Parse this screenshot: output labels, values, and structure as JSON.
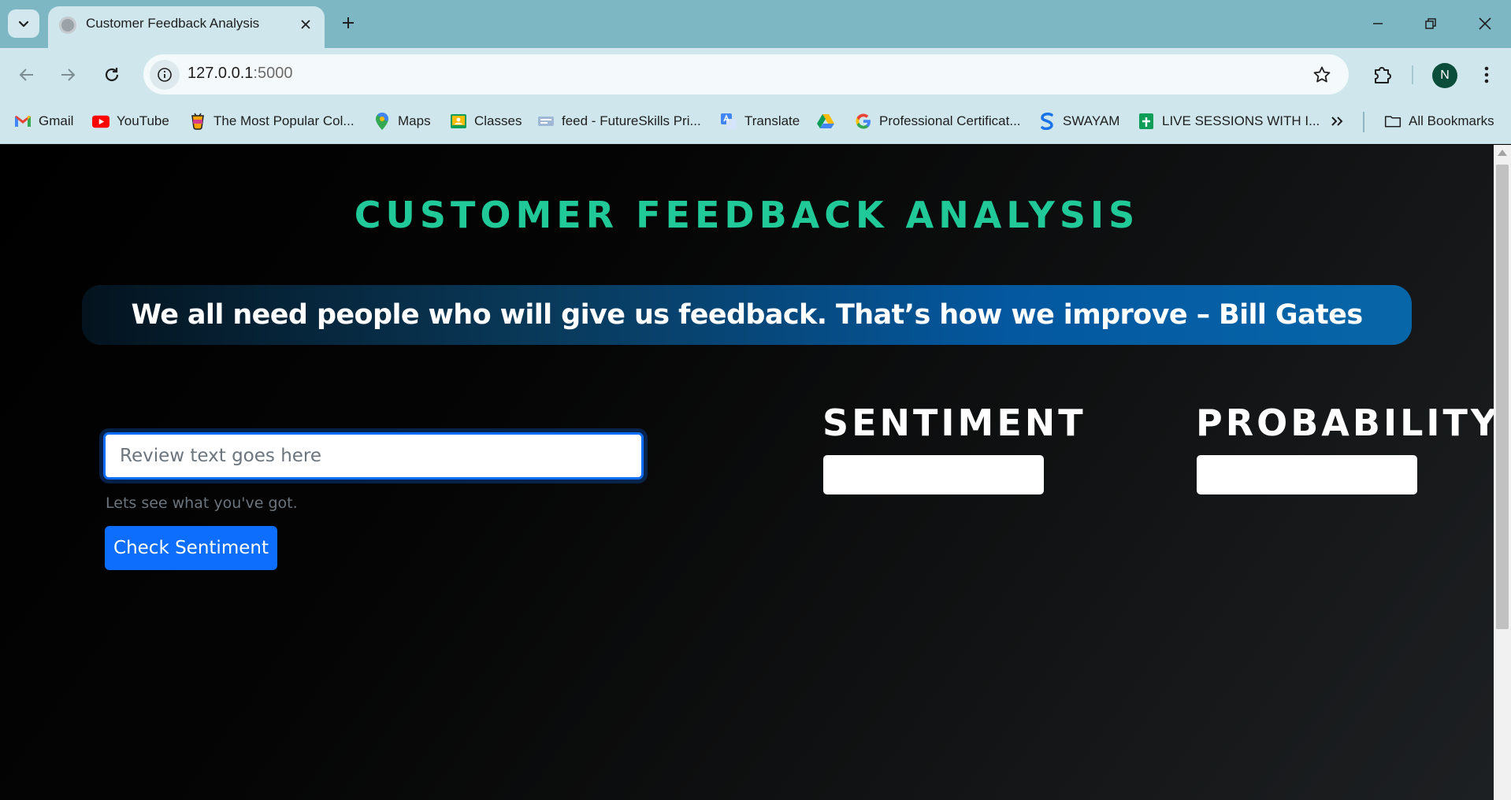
{
  "browser": {
    "tab": {
      "title": "Customer Feedback Analysis"
    },
    "address": {
      "host": "127.0.0.1",
      "port": ":5000"
    },
    "profile_initial": "N",
    "bookmarks": [
      {
        "label": "Gmail",
        "icon": "gmail-icon"
      },
      {
        "label": "YouTube",
        "icon": "youtube-icon"
      },
      {
        "label": "The Most Popular Col...",
        "icon": "cup-icon"
      },
      {
        "label": "Maps",
        "icon": "maps-icon"
      },
      {
        "label": "Classes",
        "icon": "classroom-icon"
      },
      {
        "label": "feed - FutureSkills Pri...",
        "icon": "futureskills-icon"
      },
      {
        "label": "Translate",
        "icon": "translate-icon"
      },
      {
        "label": "",
        "icon": "drive-icon"
      },
      {
        "label": "Professional Certificat...",
        "icon": "google-icon"
      },
      {
        "label": "SWAYAM",
        "icon": "swayam-icon"
      },
      {
        "label": "LIVE SESSIONS WITH I...",
        "icon": "sheets-icon"
      }
    ],
    "all_bookmarks": "All Bookmarks"
  },
  "page": {
    "title": "CUSTOMER FEEDBACK ANALYSIS",
    "quote": "We all need people who will give us feedback. That’s how we improve – Bill Gates",
    "review_input": {
      "placeholder": "Review text goes here",
      "value": ""
    },
    "help_text": "Lets see what you've got.",
    "submit_label": "Check Sentiment",
    "sentiment_label": "SENTIMENT",
    "probability_label": "PROBABILITY",
    "sentiment_value": "",
    "probability_value": ""
  },
  "colors": {
    "accent_green": "#20c997",
    "primary_blue": "#0d6efd",
    "chrome_tabstrip": "#7eb7c4",
    "chrome_toolbar": "#cfe6ec"
  }
}
